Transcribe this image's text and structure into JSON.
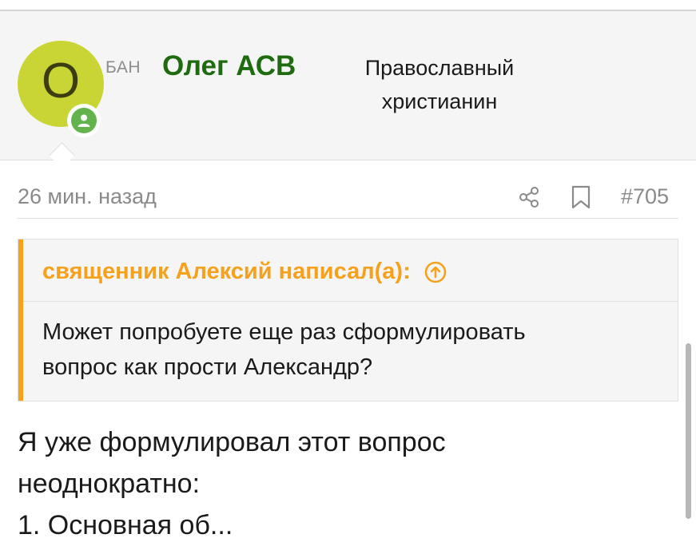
{
  "header": {
    "avatar_letter": "О",
    "ban_label": "БАН",
    "username": "Олег АСВ",
    "user_title_line1": "Православный",
    "user_title_line2": "христианин"
  },
  "post_meta": {
    "time": "26 мин. назад",
    "share_icon": "share-icon",
    "bookmark_icon": "bookmark-icon",
    "post_number": "#705"
  },
  "quote": {
    "author": "священник Алексий написал(а):",
    "text_line1": "Может попробуете еще раз сформулировать",
    "text_line2": "вопрос как прости Александр?"
  },
  "body": {
    "line1": "Я уже формулировал этот вопрос",
    "line2": "неоднократно:",
    "line3": "1. Основная об..."
  },
  "colors": {
    "username": "#1f6b10",
    "quote_accent": "#f5a11c",
    "avatar_bg": "#c9d535",
    "online_badge": "#62b34b"
  }
}
